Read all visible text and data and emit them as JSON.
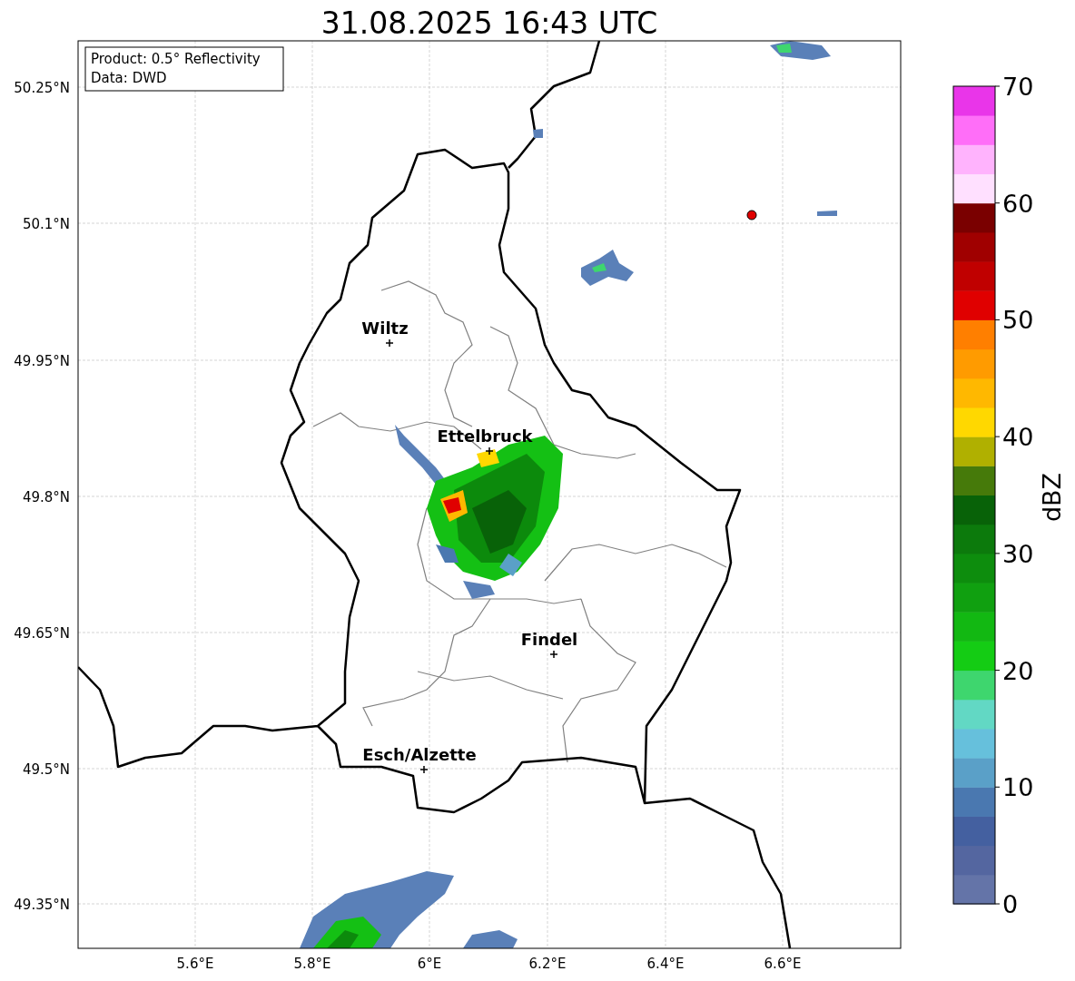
{
  "title": "31.08.2025 16:43 UTC",
  "info_box": [
    "Product: 0.5° Reflectivity",
    "Data: DWD"
  ],
  "y_ticks": [
    "50.25°N",
    "50.1°N",
    "49.95°N",
    "49.8°N",
    "49.65°N",
    "49.5°N",
    "49.35°N"
  ],
  "x_ticks": [
    "5.6°E",
    "5.8°E",
    "6°E",
    "6.2°E",
    "6.4°E",
    "6.6°E"
  ],
  "cities": [
    {
      "name": "Wiltz"
    },
    {
      "name": "Ettelbruck"
    },
    {
      "name": "Findel"
    },
    {
      "name": "Esch/Alzette"
    }
  ],
  "colorbar": {
    "label": "dBZ",
    "ticks": [
      "70",
      "60",
      "50",
      "40",
      "30",
      "20",
      "10",
      "0"
    ],
    "segments": [
      {
        "color": "#6474a8"
      },
      {
        "color": "#5466a0"
      },
      {
        "color": "#4460a0"
      },
      {
        "color": "#4a78b0"
      },
      {
        "color": "#5aa0c8"
      },
      {
        "color": "#66c0dc"
      },
      {
        "color": "#62d8c4"
      },
      {
        "color": "#3ed66e"
      },
      {
        "color": "#14cc14"
      },
      {
        "color": "#12b812"
      },
      {
        "color": "#10a010"
      },
      {
        "color": "#0d8d0d"
      },
      {
        "color": "#0c7a0c"
      },
      {
        "color": "#086208"
      },
      {
        "color": "#467a0a"
      },
      {
        "color": "#b0b000"
      },
      {
        "color": "#ffd800"
      },
      {
        "color": "#ffb800"
      },
      {
        "color": "#ff9b00"
      },
      {
        "color": "#ff7f00"
      },
      {
        "color": "#e00000"
      },
      {
        "color": "#c00000"
      },
      {
        "color": "#a00000"
      },
      {
        "color": "#7a0000"
      },
      {
        "color": "#ffe0ff"
      },
      {
        "color": "#ffb3fd"
      },
      {
        "color": "#ff6ef8"
      },
      {
        "color": "#e935e9"
      }
    ]
  }
}
